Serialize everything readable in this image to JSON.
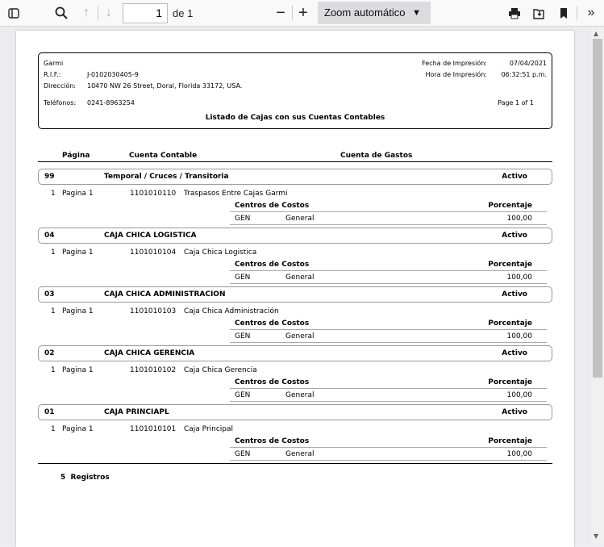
{
  "toolbar": {
    "page_number": "1",
    "page_of": "de 1",
    "zoom": "Zoom automático"
  },
  "report": {
    "company": "Garmi",
    "rif_label": "R.I.F.:",
    "rif": "J-0102030405-9",
    "address_label": "Dirección:",
    "address": "10470 NW 26 Street, Doral, Florida 33172, USA.",
    "phones_label": "Teléfonos:",
    "phones": "0241-8963254",
    "print_date_label": "Fecha de Impresión:",
    "print_date": "07/04/2021",
    "print_time_label": "Hora de Impresión:",
    "print_time": "06:32:51 p.m.",
    "page_info": "Page 1 of 1",
    "title": "Listado de Cajas con sus Cuentas Contables",
    "columns": {
      "pagina": "Página",
      "cuenta": "Cuenta Contable",
      "gastos": "Cuenta de Gastos"
    },
    "cc_header": "Centros de Costos",
    "pct_header": "Porcentaje",
    "groups": [
      {
        "code": "99",
        "name": "Temporal / Cruces / Transitoria",
        "status": "Activo",
        "n": "1",
        "pagina": "Pagina 1",
        "account": "1101010110",
        "account_name": "Traspasos Entre Cajas Garmi",
        "cc_code": "GEN",
        "cc_name": "General",
        "pct": "100,00"
      },
      {
        "code": "04",
        "name": "CAJA CHICA LOGISTICA",
        "status": "Activo",
        "n": "1",
        "pagina": "Pagina 1",
        "account": "1101010104",
        "account_name": "Caja Chica Logistica",
        "cc_code": "GEN",
        "cc_name": "General",
        "pct": "100,00"
      },
      {
        "code": "03",
        "name": "CAJA CHICA ADMINISTRACION",
        "status": "Activo",
        "n": "1",
        "pagina": "Pagina 1",
        "account": "1101010103",
        "account_name": "Caja Chica Administración",
        "cc_code": "GEN",
        "cc_name": "General",
        "pct": "100,00"
      },
      {
        "code": "02",
        "name": "CAJA CHICA GERENCIA",
        "status": "Activo",
        "n": "1",
        "pagina": "Pagina 1",
        "account": "1101010102",
        "account_name": "Caja Chica Gerencia",
        "cc_code": "GEN",
        "cc_name": "General",
        "pct": "100,00"
      },
      {
        "code": "01",
        "name": "CAJA PRINCIAPL",
        "status": "Activo",
        "n": "1",
        "pagina": "Pagina 1",
        "account": "1101010101",
        "account_name": "Caja Principal",
        "cc_code": "GEN",
        "cc_name": "General",
        "pct": "100,00"
      }
    ],
    "total_count": "5",
    "total_label": "Registros"
  }
}
